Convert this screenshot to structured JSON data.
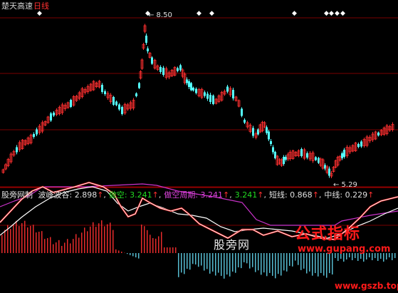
{
  "header": {
    "stock_name": "楚天高速",
    "period": "日线"
  },
  "price_panel": {
    "high_label": "8.50",
    "low_label": "5.29",
    "signal_marks": [
      "◆",
      "◆",
      "◆",
      "◆",
      "◆",
      "◆",
      "◆",
      "◆",
      "◆"
    ]
  },
  "indicator_bar": {
    "name": "股旁网制",
    "items": [
      {
        "label": "波峰波谷",
        "value": "2.898",
        "color": "#e0e0e0",
        "arrow": "↑"
      },
      {
        "label": "做空",
        "value": "3.241",
        "color": "#22dd22",
        "arrow": "↑"
      },
      {
        "label": "做空周期",
        "value": "3.241",
        "color": "#dd44dd",
        "arrow": "↑"
      },
      {
        "label": "",
        "value": "3.241",
        "color": "#22dd22",
        "arrow": "↑"
      },
      {
        "label": "短线",
        "value": "0.868",
        "color": "#e0e0e0",
        "arrow": "↑"
      },
      {
        "label": "中线",
        "value": "0.229",
        "color": "#e0e0e0",
        "arrow": "↑"
      }
    ]
  },
  "watermark": {
    "text": "股旁网",
    "url": "www.gupang.com",
    "logo": "公式指标",
    "site": "www.gszb.top"
  },
  "colors": {
    "up_candle": "#ff3030",
    "down_candle": "#54ffff",
    "grid": "#7a0000",
    "white_line": "#ffffff",
    "red_line": "#e01010",
    "magenta_line": "#cc33cc"
  },
  "chart_data": {
    "type": "line",
    "title": "楚天高速 日线",
    "price_max": 8.5,
    "price_min": 5.29,
    "indicator_values": {
      "波峰波谷": 2.898,
      "做空": 3.241,
      "做空周期": 3.241,
      "短线": 0.868,
      "中线": 0.229
    }
  }
}
